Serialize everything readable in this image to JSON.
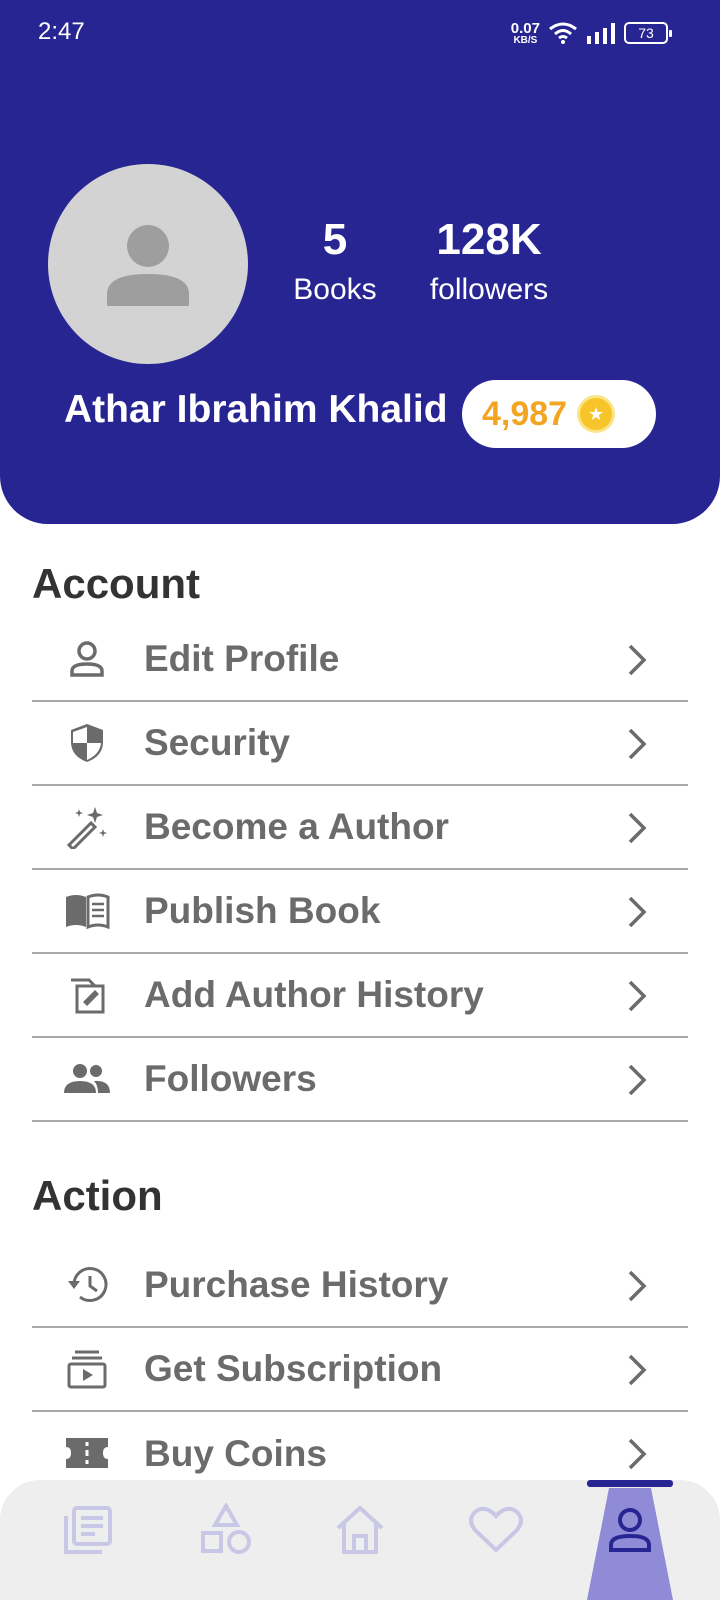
{
  "status_bar": {
    "time": "2:47",
    "net_speed_value": "0.07",
    "net_speed_unit": "KB/S",
    "battery": "73"
  },
  "profile": {
    "books_count": "5",
    "books_label": "Books",
    "followers_count": "128K",
    "followers_label": "followers",
    "name": "Athar Ibrahim Khalid",
    "coins": "4,987"
  },
  "account": {
    "title": "Account",
    "items": [
      {
        "label": "Edit Profile",
        "icon": "person-icon"
      },
      {
        "label": "Security",
        "icon": "shield-icon"
      },
      {
        "label": "Become a Author",
        "icon": "magic-wand-icon"
      },
      {
        "label": "Publish Book",
        "icon": "book-icon"
      },
      {
        "label": "Add Author History",
        "icon": "history-edit-icon"
      },
      {
        "label": "Followers",
        "icon": "group-icon"
      }
    ]
  },
  "action": {
    "title": "Action",
    "items": [
      {
        "label": "Purchase History",
        "icon": "history-icon"
      },
      {
        "label": "Get Subscription",
        "icon": "subscription-icon"
      },
      {
        "label": "Buy Coins",
        "icon": "ticket-icon"
      }
    ]
  },
  "bottom_nav": {
    "items": [
      "library-icon",
      "categories-icon",
      "home-icon",
      "favorites-icon",
      "profile-icon"
    ],
    "active": "profile-icon"
  },
  "colors": {
    "header": "#272592",
    "coins": "#f3a522",
    "menu_text": "#6b6b6b",
    "nav_inactive": "#c8c8e6"
  }
}
